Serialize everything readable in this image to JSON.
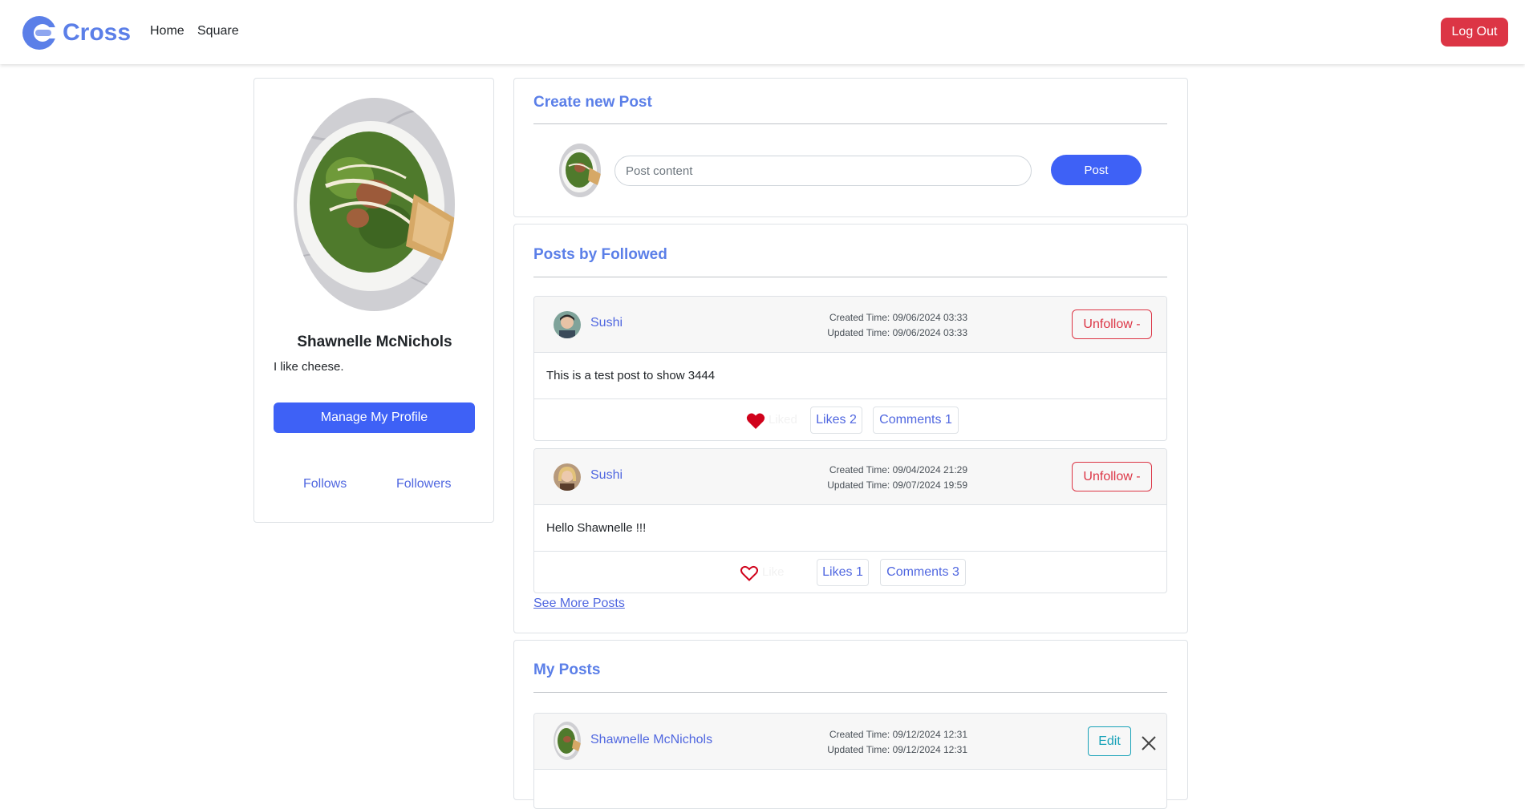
{
  "nav": {
    "brand": "Cross",
    "links": [
      "Home",
      "Square"
    ],
    "logout": "Log Out"
  },
  "profile": {
    "name": "Shawnelle McNichols",
    "bio": "I like cheese.",
    "manage_label": "Manage My Profile",
    "follows_label": "Follows",
    "followers_label": "Followers"
  },
  "create": {
    "title": "Create new Post",
    "placeholder": "Post content",
    "post_label": "Post"
  },
  "followed": {
    "title": "Posts by Followed",
    "see_more": "See More Posts",
    "posts": [
      {
        "author": "Sushi",
        "created": "Created Time: 09/06/2024 03:33",
        "updated": "Updated Time: 09/06/2024 03:33",
        "action": "Unfollow -",
        "content": "This is a test post to show 3444",
        "liked": true,
        "like_word": "Liked",
        "likes": "Likes 2",
        "comments": "Comments 1"
      },
      {
        "author": "Sushi",
        "created": "Created Time: 09/04/2024 21:29",
        "updated": "Updated Time: 09/07/2024 19:59",
        "action": "Unfollow -",
        "content": "Hello Shawnelle !!!",
        "liked": false,
        "like_word": "Like",
        "likes": "Likes 1",
        "comments": "Comments 3"
      }
    ]
  },
  "mine": {
    "title": "My Posts",
    "posts": [
      {
        "author": "Shawnelle McNichols",
        "created": "Created Time: 09/12/2024 12:31",
        "updated": "Updated Time: 09/12/2024 12:31",
        "edit": "Edit"
      }
    ]
  },
  "colors": {
    "brand": "#5b7fe8",
    "primary": "#3e61f6",
    "danger": "#dc3545",
    "info": "#17a2b8",
    "link": "#5067e0"
  }
}
